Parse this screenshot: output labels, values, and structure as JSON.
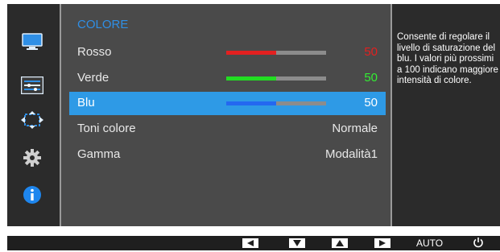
{
  "menu": {
    "title": "COLORE",
    "items": [
      {
        "label": "Rosso",
        "value": "50",
        "level": 0.5,
        "fill_color": "#e32020",
        "value_color": "#e32020"
      },
      {
        "label": "Verde",
        "value": "50",
        "level": 0.5,
        "fill_color": "#22dd22",
        "value_color": "#33ee33"
      },
      {
        "label": "Blu",
        "value": "50",
        "level": 0.5,
        "fill_color": "#2468f0",
        "value_color": "#ffffff",
        "selected": true
      },
      {
        "label": "Toni colore",
        "value": "Normale"
      },
      {
        "label": "Gamma",
        "value": "Modalità1"
      }
    ]
  },
  "help_text": "Consente di regolare il livello di saturazione del blu. I valori più prossimi a 100 indicano maggiore intensità di colore.",
  "sidebar_icons": [
    "monitor-icon",
    "color-adjust-icon",
    "resize-icon",
    "settings-gear-icon",
    "info-icon"
  ],
  "bottom": {
    "buttons": [
      "left-arrow-icon",
      "down-arrow-icon",
      "up-arrow-icon",
      "right-arrow-icon"
    ],
    "auto_label": "AUTO",
    "power_icon": "power-icon"
  },
  "colors": {
    "accent": "#2e9ae6",
    "panel": "#4a4a4a",
    "sidebar": "#2b2b2b"
  }
}
